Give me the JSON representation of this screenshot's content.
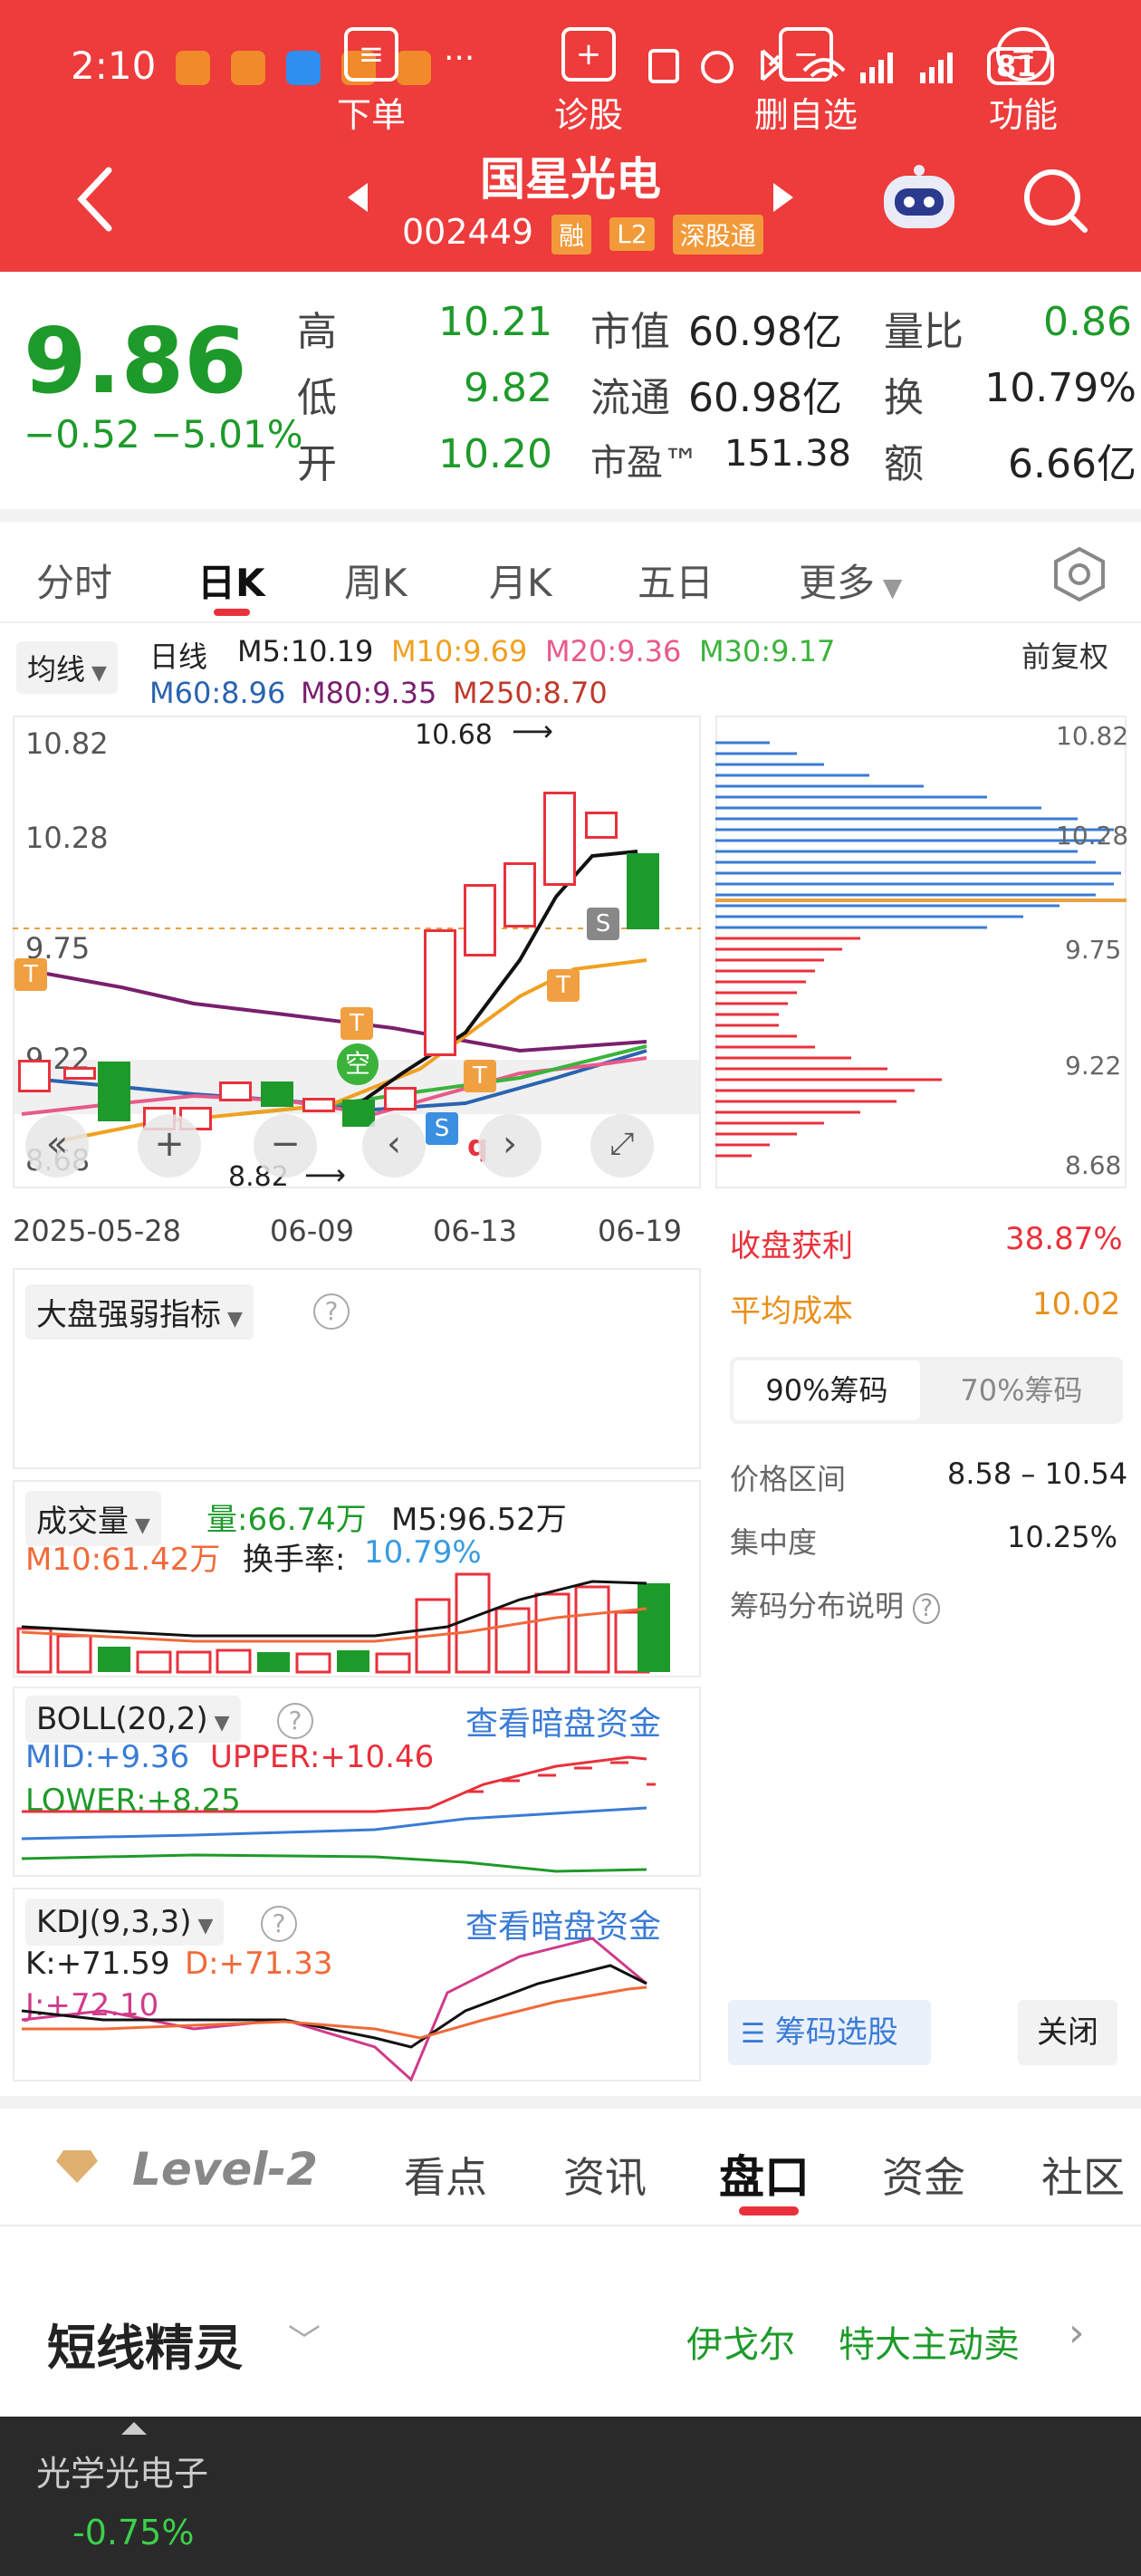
{
  "status_bar": {
    "time": "2:10",
    "dots": "···",
    "battery": "81"
  },
  "header": {
    "title": "国星光电",
    "code": "002449",
    "badges": [
      "融",
      "L2",
      "深股通"
    ]
  },
  "quote": {
    "price": "9.86",
    "change": "−0.52",
    "change_pct": "−5.01%",
    "high_label": "高",
    "high": "10.21",
    "low_label": "低",
    "low": "9.82",
    "open_label": "开",
    "open": "10.20",
    "mcap_label": "市值",
    "mcap": "60.98亿",
    "float_label": "流通",
    "float": "60.98亿",
    "pe_label": "市盈™",
    "pe": "151.38",
    "vr_label": "量比",
    "vr": "0.86",
    "turn_label": "换",
    "turn": "10.79%",
    "amt_label": "额",
    "amt": "6.66亿"
  },
  "period_tabs": [
    "分时",
    "日K",
    "周K",
    "月K",
    "五日",
    "更多"
  ],
  "selected_tab": "日K",
  "ma": {
    "selector": "均线",
    "kind": "日线",
    "m5": "M5:10.19",
    "m10": "M10:9.69",
    "m20": "M20:9.36",
    "m30": "M30:9.17",
    "m60": "M60:8.96",
    "m80": "M80:9.35",
    "m250": "M250:8.70",
    "adjust": "前复权"
  },
  "kline": {
    "y_ticks": [
      "10.82",
      "10.28",
      "9.75",
      "9.22",
      "8.68"
    ],
    "x_ticks": [
      "2025-05-28",
      "06-09",
      "06-13",
      "06-19"
    ],
    "high_note": "10.68",
    "low_note": "8.82",
    "markers": {
      "t": "T",
      "s": "S",
      "kong": "空",
      "q": "q"
    }
  },
  "chips": {
    "y_ticks": [
      "10.82",
      "10.28",
      "9.75",
      "9.22",
      "8.68"
    ],
    "profit_label": "收盘获利",
    "profit": "38.87%",
    "avg_label": "平均成本",
    "avg": "10.02",
    "tab90": "90%筹码",
    "tab70": "70%筹码",
    "range_label": "价格区间",
    "range": "8.58 – 10.54",
    "conc_label": "集中度",
    "conc": "10.25%",
    "explain": "筹码分布说明",
    "select_btn": "筹码选股",
    "close_btn": "关闭"
  },
  "market_strength": {
    "label": "大盘强弱指标"
  },
  "volume": {
    "label": "成交量",
    "vol": "量:66.74万",
    "m5": "M5:96.52万",
    "m10": "M10:61.42万",
    "turn_label": "换手率:",
    "turn": "10.79%"
  },
  "boll": {
    "label": "BOLL(20,2)",
    "link": "查看暗盘资金",
    "mid": "MID:+9.36",
    "upper": "UPPER:+10.46",
    "lower": "LOWER:+8.25"
  },
  "kdj": {
    "label": "KDJ(9,3,3)",
    "link": "查看暗盘资金",
    "k": "K:+71.59",
    "d": "D:+71.33",
    "j": "J:+72.10"
  },
  "info_tabs": [
    "Level-2",
    "看点",
    "资讯",
    "盘口",
    "资金",
    "社区"
  ],
  "selected_info_tab": "盘口",
  "sprite": {
    "title": "短线精灵",
    "item1": "伊戈尔",
    "item2": "特大主动卖"
  },
  "bottom_bar": {
    "sector": "光学光电子",
    "sector_pct": "-0.75%",
    "items": [
      "下单",
      "诊股",
      "删自选",
      "功能"
    ]
  },
  "colors": {
    "up": "#e8313c",
    "down": "#1e9a2a",
    "header": "#ee3b3b",
    "link": "#3a7bd5"
  }
}
